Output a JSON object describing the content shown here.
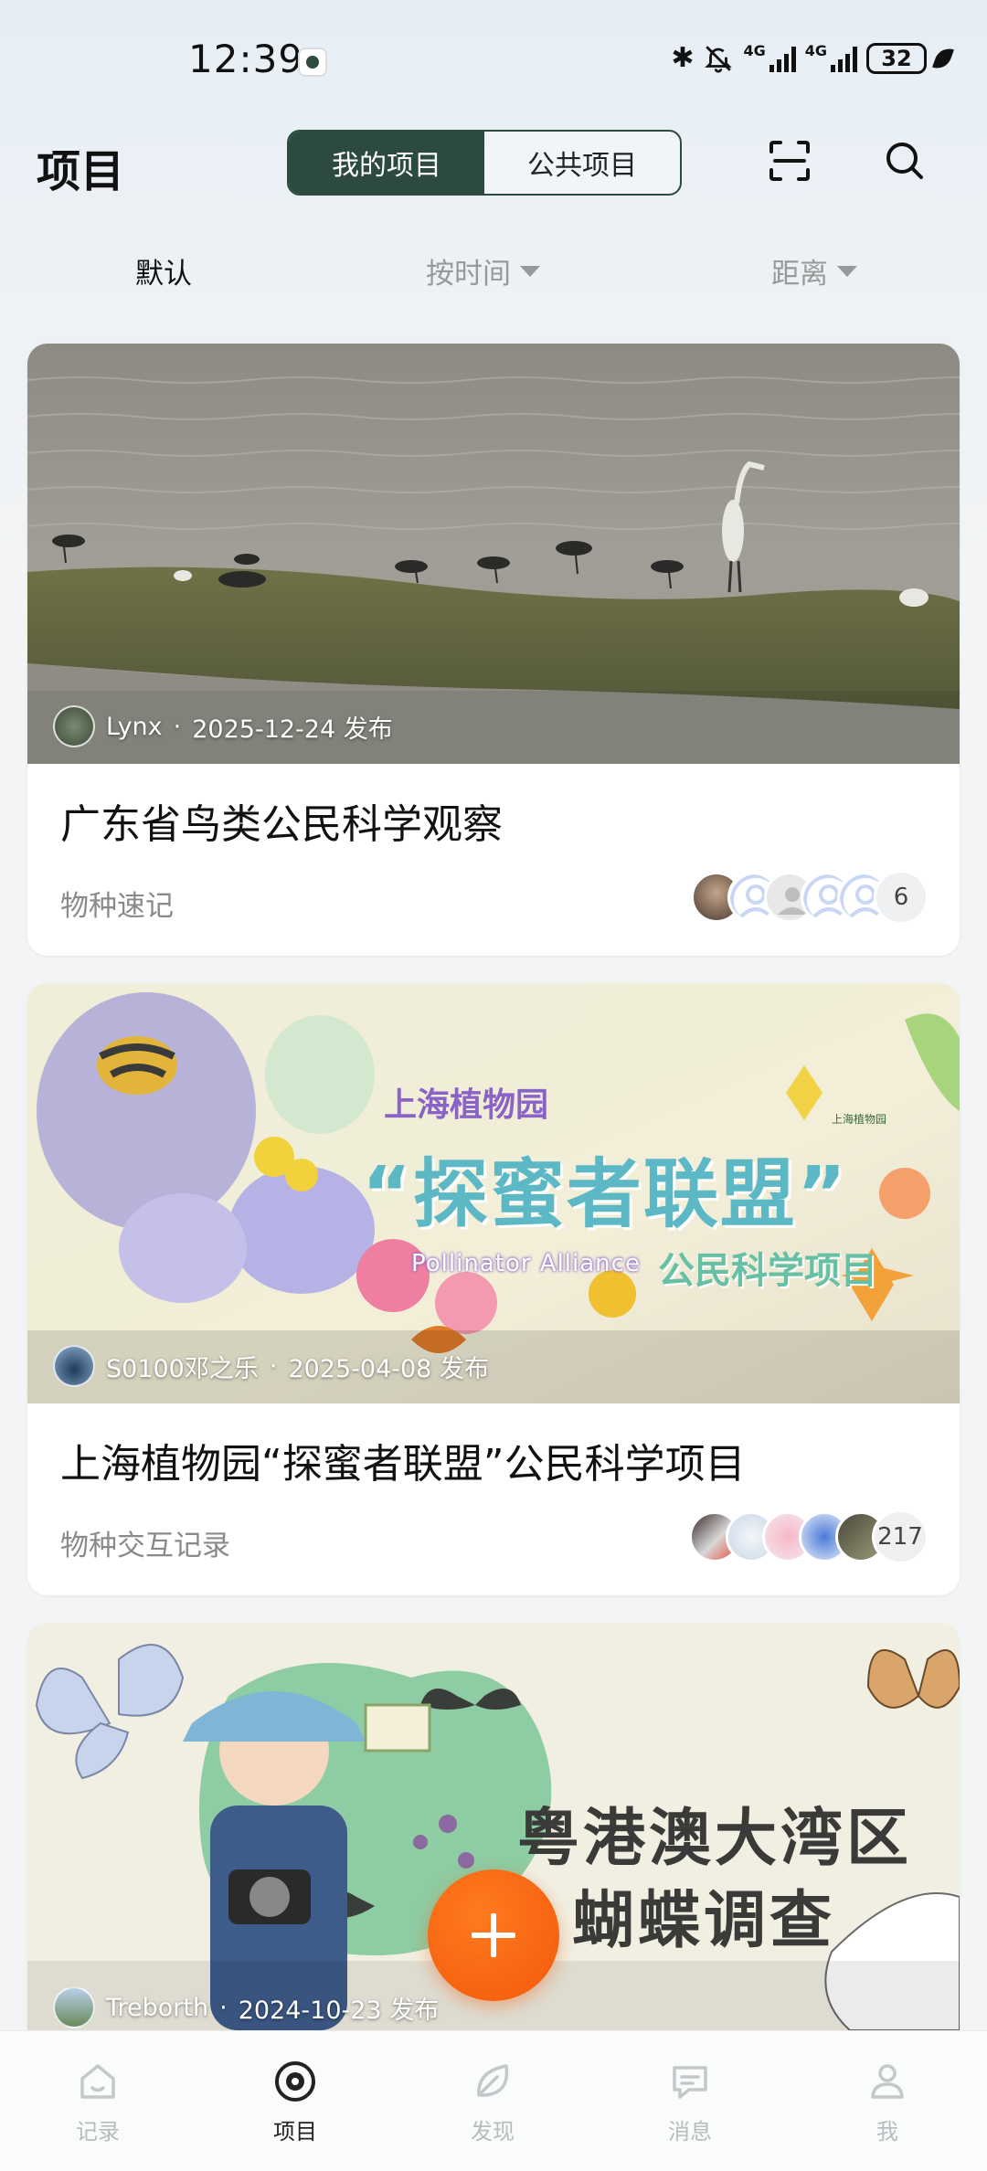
{
  "status_bar": {
    "time": "12:39",
    "network_1": "4G",
    "network_2": "4G",
    "battery": "32"
  },
  "header": {
    "title": "项目",
    "tabs": [
      {
        "label": "我的项目",
        "active": true
      },
      {
        "label": "公共项目",
        "active": false
      }
    ]
  },
  "sort": {
    "default_label": "默认",
    "time_label": "按时间",
    "distance_label": "距离"
  },
  "projects": [
    {
      "author": "Lynx",
      "date": "2025-12-24 发布",
      "title": "广东省鸟类公民科学观察",
      "type": "物种速记",
      "member_count": "6"
    },
    {
      "author": "S0100邓之乐",
      "date": "2025-04-08 发布",
      "title": "上海植物园“探蜜者联盟”公民科学项目",
      "type": "物种交互记录",
      "member_count": "217",
      "cover_text": {
        "org": "上海植物园",
        "headline": "“探蜜者联盟”",
        "english": "Pollinator Alliance",
        "sub": "公民科学项目",
        "logo": "上海植物园"
      }
    },
    {
      "author": "Treborth",
      "date": "2024-10-23 发布",
      "cover_text": {
        "line1": "粤港澳大湾区",
        "line2": "蝴蝶调查"
      }
    }
  ],
  "bottom_nav": [
    {
      "label": "记录",
      "icon": "home-icon"
    },
    {
      "label": "项目",
      "icon": "target-icon",
      "active": true
    },
    {
      "label": "发现",
      "icon": "leaf-icon"
    },
    {
      "label": "消息",
      "icon": "chat-icon"
    },
    {
      "label": "我",
      "icon": "person-icon"
    }
  ],
  "colors": {
    "accent": "#2c4a3e",
    "fab": "#f25a0c"
  }
}
